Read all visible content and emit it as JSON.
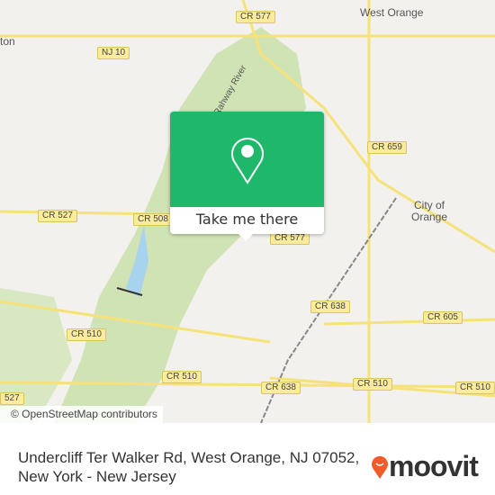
{
  "map": {
    "towns": [
      "West Orange",
      "ton",
      "City of Orange"
    ],
    "roads": [
      "NJ 10",
      "CR 577",
      "CR 659",
      "CR 527",
      "CR 508",
      "CR 577",
      "CR 638",
      "CR 638",
      "CR 605",
      "CR 510",
      "CR 510",
      "CR 510",
      "CR 510",
      "527"
    ],
    "river": "Rahway River",
    "attribution": "© OpenStreetMap contributors"
  },
  "popup": {
    "icon": "map-pin-icon",
    "button_label": "Take me there",
    "color": "#1fb86b"
  },
  "footer": {
    "address_line1": "Undercliff Ter Walker Rd, West Orange, NJ 07052,",
    "address_line2": "New York - New Jersey",
    "brand": "moovit",
    "brand_color": "#f15a29"
  }
}
